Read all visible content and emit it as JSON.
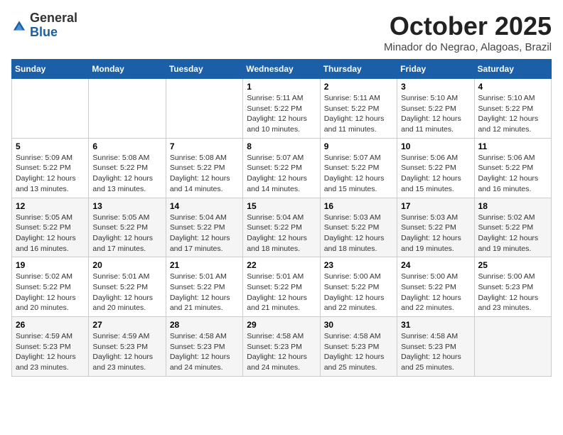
{
  "header": {
    "logo_general": "General",
    "logo_blue": "Blue",
    "month_title": "October 2025",
    "location": "Minador do Negrao, Alagoas, Brazil"
  },
  "columns": [
    "Sunday",
    "Monday",
    "Tuesday",
    "Wednesday",
    "Thursday",
    "Friday",
    "Saturday"
  ],
  "weeks": [
    [
      {
        "day": "",
        "sunrise": "",
        "sunset": "",
        "daylight": ""
      },
      {
        "day": "",
        "sunrise": "",
        "sunset": "",
        "daylight": ""
      },
      {
        "day": "",
        "sunrise": "",
        "sunset": "",
        "daylight": ""
      },
      {
        "day": "1",
        "sunrise": "Sunrise: 5:11 AM",
        "sunset": "Sunset: 5:22 PM",
        "daylight": "Daylight: 12 hours and 10 minutes."
      },
      {
        "day": "2",
        "sunrise": "Sunrise: 5:11 AM",
        "sunset": "Sunset: 5:22 PM",
        "daylight": "Daylight: 12 hours and 11 minutes."
      },
      {
        "day": "3",
        "sunrise": "Sunrise: 5:10 AM",
        "sunset": "Sunset: 5:22 PM",
        "daylight": "Daylight: 12 hours and 11 minutes."
      },
      {
        "day": "4",
        "sunrise": "Sunrise: 5:10 AM",
        "sunset": "Sunset: 5:22 PM",
        "daylight": "Daylight: 12 hours and 12 minutes."
      }
    ],
    [
      {
        "day": "5",
        "sunrise": "Sunrise: 5:09 AM",
        "sunset": "Sunset: 5:22 PM",
        "daylight": "Daylight: 12 hours and 13 minutes."
      },
      {
        "day": "6",
        "sunrise": "Sunrise: 5:08 AM",
        "sunset": "Sunset: 5:22 PM",
        "daylight": "Daylight: 12 hours and 13 minutes."
      },
      {
        "day": "7",
        "sunrise": "Sunrise: 5:08 AM",
        "sunset": "Sunset: 5:22 PM",
        "daylight": "Daylight: 12 hours and 14 minutes."
      },
      {
        "day": "8",
        "sunrise": "Sunrise: 5:07 AM",
        "sunset": "Sunset: 5:22 PM",
        "daylight": "Daylight: 12 hours and 14 minutes."
      },
      {
        "day": "9",
        "sunrise": "Sunrise: 5:07 AM",
        "sunset": "Sunset: 5:22 PM",
        "daylight": "Daylight: 12 hours and 15 minutes."
      },
      {
        "day": "10",
        "sunrise": "Sunrise: 5:06 AM",
        "sunset": "Sunset: 5:22 PM",
        "daylight": "Daylight: 12 hours and 15 minutes."
      },
      {
        "day": "11",
        "sunrise": "Sunrise: 5:06 AM",
        "sunset": "Sunset: 5:22 PM",
        "daylight": "Daylight: 12 hours and 16 minutes."
      }
    ],
    [
      {
        "day": "12",
        "sunrise": "Sunrise: 5:05 AM",
        "sunset": "Sunset: 5:22 PM",
        "daylight": "Daylight: 12 hours and 16 minutes."
      },
      {
        "day": "13",
        "sunrise": "Sunrise: 5:05 AM",
        "sunset": "Sunset: 5:22 PM",
        "daylight": "Daylight: 12 hours and 17 minutes."
      },
      {
        "day": "14",
        "sunrise": "Sunrise: 5:04 AM",
        "sunset": "Sunset: 5:22 PM",
        "daylight": "Daylight: 12 hours and 17 minutes."
      },
      {
        "day": "15",
        "sunrise": "Sunrise: 5:04 AM",
        "sunset": "Sunset: 5:22 PM",
        "daylight": "Daylight: 12 hours and 18 minutes."
      },
      {
        "day": "16",
        "sunrise": "Sunrise: 5:03 AM",
        "sunset": "Sunset: 5:22 PM",
        "daylight": "Daylight: 12 hours and 18 minutes."
      },
      {
        "day": "17",
        "sunrise": "Sunrise: 5:03 AM",
        "sunset": "Sunset: 5:22 PM",
        "daylight": "Daylight: 12 hours and 19 minutes."
      },
      {
        "day": "18",
        "sunrise": "Sunrise: 5:02 AM",
        "sunset": "Sunset: 5:22 PM",
        "daylight": "Daylight: 12 hours and 19 minutes."
      }
    ],
    [
      {
        "day": "19",
        "sunrise": "Sunrise: 5:02 AM",
        "sunset": "Sunset: 5:22 PM",
        "daylight": "Daylight: 12 hours and 20 minutes."
      },
      {
        "day": "20",
        "sunrise": "Sunrise: 5:01 AM",
        "sunset": "Sunset: 5:22 PM",
        "daylight": "Daylight: 12 hours and 20 minutes."
      },
      {
        "day": "21",
        "sunrise": "Sunrise: 5:01 AM",
        "sunset": "Sunset: 5:22 PM",
        "daylight": "Daylight: 12 hours and 21 minutes."
      },
      {
        "day": "22",
        "sunrise": "Sunrise: 5:01 AM",
        "sunset": "Sunset: 5:22 PM",
        "daylight": "Daylight: 12 hours and 21 minutes."
      },
      {
        "day": "23",
        "sunrise": "Sunrise: 5:00 AM",
        "sunset": "Sunset: 5:22 PM",
        "daylight": "Daylight: 12 hours and 22 minutes."
      },
      {
        "day": "24",
        "sunrise": "Sunrise: 5:00 AM",
        "sunset": "Sunset: 5:22 PM",
        "daylight": "Daylight: 12 hours and 22 minutes."
      },
      {
        "day": "25",
        "sunrise": "Sunrise: 5:00 AM",
        "sunset": "Sunset: 5:23 PM",
        "daylight": "Daylight: 12 hours and 23 minutes."
      }
    ],
    [
      {
        "day": "26",
        "sunrise": "Sunrise: 4:59 AM",
        "sunset": "Sunset: 5:23 PM",
        "daylight": "Daylight: 12 hours and 23 minutes."
      },
      {
        "day": "27",
        "sunrise": "Sunrise: 4:59 AM",
        "sunset": "Sunset: 5:23 PM",
        "daylight": "Daylight: 12 hours and 23 minutes."
      },
      {
        "day": "28",
        "sunrise": "Sunrise: 4:58 AM",
        "sunset": "Sunset: 5:23 PM",
        "daylight": "Daylight: 12 hours and 24 minutes."
      },
      {
        "day": "29",
        "sunrise": "Sunrise: 4:58 AM",
        "sunset": "Sunset: 5:23 PM",
        "daylight": "Daylight: 12 hours and 24 minutes."
      },
      {
        "day": "30",
        "sunrise": "Sunrise: 4:58 AM",
        "sunset": "Sunset: 5:23 PM",
        "daylight": "Daylight: 12 hours and 25 minutes."
      },
      {
        "day": "31",
        "sunrise": "Sunrise: 4:58 AM",
        "sunset": "Sunset: 5:23 PM",
        "daylight": "Daylight: 12 hours and 25 minutes."
      },
      {
        "day": "",
        "sunrise": "",
        "sunset": "",
        "daylight": ""
      }
    ]
  ]
}
